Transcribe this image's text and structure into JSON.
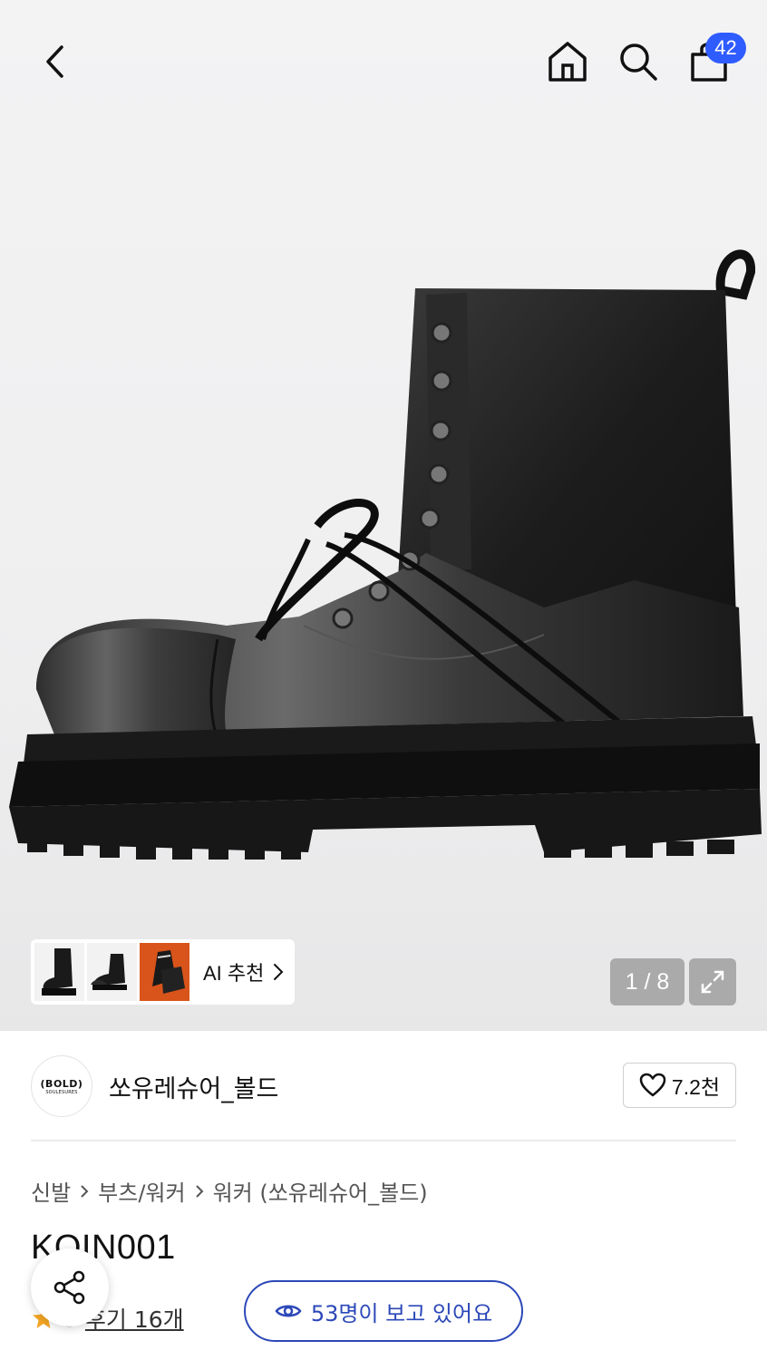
{
  "header": {
    "back_icon": "chevron-left-icon",
    "home_icon": "home-icon",
    "search_icon": "search-icon",
    "cart_icon": "shopping-bag-icon",
    "cart_count": "42",
    "badge_color": "#2f5cff"
  },
  "gallery": {
    "ai_recommend_label": "AI 추천",
    "page_counter": "1 / 8",
    "expand_icon": "expand-icon",
    "thumbnails": [
      "boot-thumbnail-1",
      "boot-thumbnail-2",
      "boot-thumbnail-3"
    ]
  },
  "seller": {
    "logo_text": "(BOLD)",
    "logo_subtext": "SOULESURES",
    "name": "쏘유레슈어_볼드",
    "likes": "7.2천"
  },
  "breadcrumb": {
    "items": [
      "신발",
      "부츠/워커",
      "워커 (쏘유레슈어_볼드)"
    ]
  },
  "product": {
    "code": "KOIN001",
    "rating": "5",
    "review_label": "후기 16개",
    "viewers_label": "53명이 보고 있어요",
    "accent_color": "#2c48b8",
    "star_color": "#f5a623"
  }
}
